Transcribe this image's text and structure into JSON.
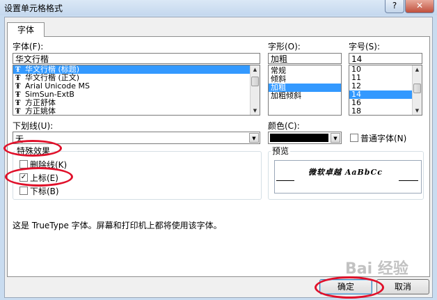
{
  "window": {
    "title": "设置单元格格式",
    "help_label": "?",
    "close_label": "✕"
  },
  "tabs": [
    {
      "label": "字体"
    }
  ],
  "font": {
    "label": "字体(F):",
    "value": "华文行楷",
    "items": [
      {
        "label": "华文行楷 (标题)",
        "selected": true
      },
      {
        "label": "华文行楷 (正文)"
      },
      {
        "label": "Arial Unicode MS"
      },
      {
        "label": "SimSun-ExtB"
      },
      {
        "label": "方正舒体"
      },
      {
        "label": "方正姚体"
      }
    ],
    "icon": "truetype-icon"
  },
  "style": {
    "label": "字形(O):",
    "value": "加粗",
    "items": [
      {
        "label": "常规"
      },
      {
        "label": "倾斜"
      },
      {
        "label": "加粗",
        "selected": true
      },
      {
        "label": "加粗倾斜"
      }
    ]
  },
  "size": {
    "label": "字号(S):",
    "value": "14",
    "items": [
      {
        "label": "10"
      },
      {
        "label": "11"
      },
      {
        "label": "12"
      },
      {
        "label": "14",
        "selected": true
      },
      {
        "label": "16"
      },
      {
        "label": "18"
      }
    ]
  },
  "underline": {
    "label": "下划线(U):",
    "value": "无"
  },
  "color": {
    "label": "颜色(C):",
    "value_color": "#000000"
  },
  "normal_font": {
    "label": "普通字体(N)",
    "checked": false
  },
  "effects": {
    "title": "特殊效果",
    "strikethrough": {
      "label": "删除线(K)",
      "checked": false
    },
    "superscript": {
      "label": "上标(E)",
      "checked": true
    },
    "subscript": {
      "label": "下标(B)",
      "checked": false
    }
  },
  "preview": {
    "title": "预览",
    "sample": "微软卓越 AaBbCc"
  },
  "info_text": "这是 TrueType 字体。屏幕和打印机上都将使用该字体。",
  "buttons": {
    "ok": "确定",
    "cancel": "取消"
  },
  "watermark": {
    "text": "Bai 经验"
  },
  "colors": {
    "annotation": "#e0102a",
    "selection": "#3399ff"
  }
}
